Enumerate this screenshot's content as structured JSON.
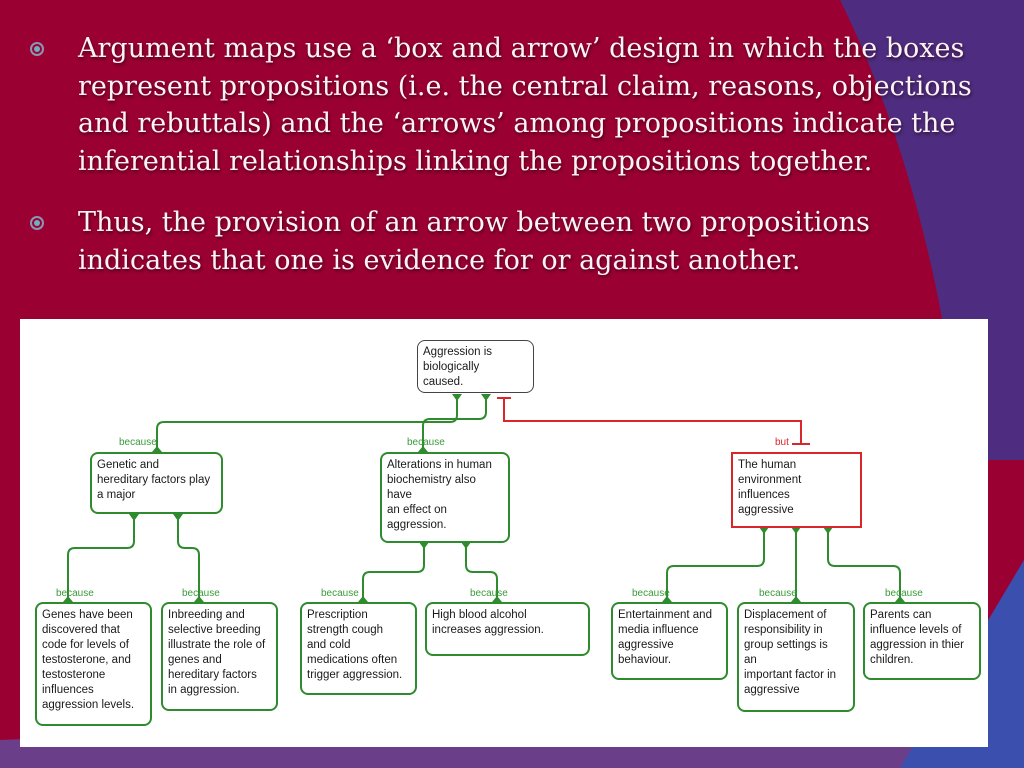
{
  "slide": {
    "bullets": [
      "Argument maps use a ‘box and arrow’ design in which the boxes represent propositions (i.e. the central claim, reasons, objections and rebuttals) and the ‘arrows’ among propositions indicate the inferential relationships linking the propositions together.",
      "Thus, the provision of an arrow between two propositions indicates that one is evidence for or against another."
    ],
    "colors": {
      "background": "#9b0033",
      "accent_purple": "#4e2d80",
      "accent_blue": "#3a4fae"
    }
  },
  "argument_map": {
    "colors": {
      "support": "#2e8b2e",
      "objection": "#d9262a",
      "root_border": "#444444"
    },
    "nodes": {
      "root": "Aggression is\nbiologically\ncaused.",
      "genetic": "Genetic and\nhereditary factors play\na major",
      "biochem": "Alterations in human\nbiochemistry also\nhave\nan effect on\naggression.",
      "environment": "The human\nenvironment\ninfluences\naggressive",
      "genes": "Genes have been\ndiscovered that\ncode for levels of\ntestosterone, and\ntestosterone\ninfluences\naggression levels.",
      "inbreeding": "Inbreeding and\nselective breeding\nillustrate the role of\ngenes and\nhereditary factors\nin aggression.",
      "prescription": "Prescription\nstrength cough\nand cold\nmedications often\ntrigger aggression.",
      "alcohol": "High blood alcohol\nincreases aggression.",
      "entertainment": "Entertainment and\nmedia influence\naggressive\nbehaviour.",
      "displacement": "Displacement of\nresponsibility in\ngroup settings is\nan\nimportant factor in\naggressive",
      "parents": "Parents can\ninfluence levels of\naggression in thier\nchildren."
    },
    "links": {
      "support_label": "because",
      "objection_label": "but"
    }
  }
}
